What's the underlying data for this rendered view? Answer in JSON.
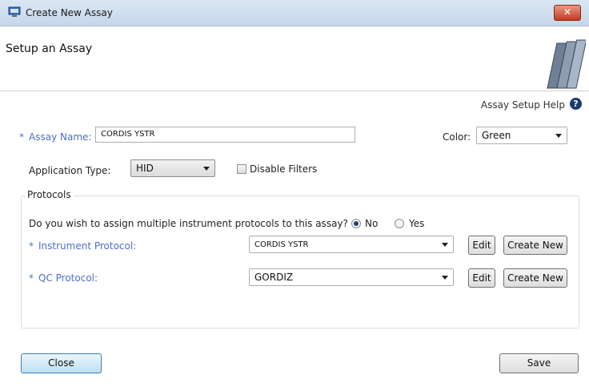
{
  "window": {
    "title": "Create New Assay",
    "close_symbol": "✕",
    "icon": "app-window-icon"
  },
  "header": {
    "title": "Setup an Assay",
    "art_icon": "books-icon"
  },
  "help": {
    "label": "Assay Setup Help",
    "icon": "question-icon",
    "icon_symbol": "?"
  },
  "form": {
    "required_marker": "*",
    "assay_name_label": "Assay Name:",
    "assay_name_value": "CORDIS YSTR",
    "color_label": "Color:",
    "color_value": "Green",
    "application_type_label": "Application Type:",
    "application_type_value": "HID",
    "disable_filters_label": "Disable Filters",
    "disable_filters_checked": false
  },
  "protocols": {
    "group_label": "Protocols",
    "question": "Do you wish to assign multiple instrument protocols to this assay?",
    "option_no": "No",
    "option_yes": "Yes",
    "selected": "No",
    "instrument_label": "Instrument Protocol:",
    "instrument_value": "CORDIS YSTR",
    "qc_label": "QC Protocol:",
    "qc_value": "GORDIZ",
    "edit_label": "Edit",
    "create_new_label": "Create New"
  },
  "footer": {
    "close_label": "Close",
    "save_label": "Save"
  },
  "colors": {
    "required": "#4f6fc5",
    "titlebar": "#c6d7ea",
    "close_red": "#c23a1f",
    "default_button": "#bfe0f5"
  }
}
